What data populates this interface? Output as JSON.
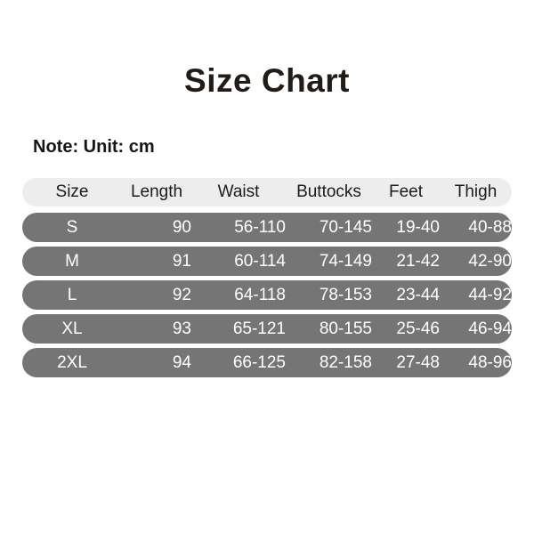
{
  "title": "Size Chart",
  "note": "Note: Unit: cm",
  "colors": {
    "title_text": "#231b17",
    "note_text": "#161616",
    "header_pill": "#ededed",
    "header_text": "#1b1b1b",
    "row_pill": "#757575",
    "row_text": "#ffffff",
    "background": "#ffffff"
  },
  "chart_data": {
    "type": "table",
    "title": "Size Chart",
    "subtitle": "Note: Unit: cm",
    "columns": [
      "Size",
      "Length",
      "Waist",
      "Buttocks",
      "Feet",
      "Thigh"
    ],
    "rows": [
      {
        "size": "S",
        "length": "90",
        "waist": "56-110",
        "buttocks": "70-145",
        "feet": "19-40",
        "thigh": "40-88"
      },
      {
        "size": "M",
        "length": "91",
        "waist": "60-114",
        "buttocks": "74-149",
        "feet": "21-42",
        "thigh": "42-90"
      },
      {
        "size": "L",
        "length": "92",
        "waist": "64-118",
        "buttocks": "78-153",
        "feet": "23-44",
        "thigh": "44-92"
      },
      {
        "size": "XL",
        "length": "93",
        "waist": "65-121",
        "buttocks": "80-155",
        "feet": "25-46",
        "thigh": "46-94"
      },
      {
        "size": "2XL",
        "length": "94",
        "waist": "66-125",
        "buttocks": "82-158",
        "feet": "27-48",
        "thigh": "48-96"
      }
    ],
    "unit": "cm"
  }
}
